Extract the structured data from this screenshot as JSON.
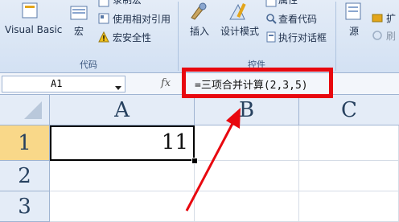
{
  "ribbon": {
    "group_code_label": "代码",
    "group_controls_label": "控件",
    "visual_basic": "Visual Basic",
    "macro": "宏",
    "record_macro": "录制宏",
    "use_relative": "使用相对引用",
    "macro_security": "宏安全性",
    "insert": "插入",
    "design_mode": "设计模式",
    "properties": "属性",
    "view_code": "查看代码",
    "run_dialog": "执行对话框",
    "source": "源",
    "expand": "扩",
    "refresh": "刷"
  },
  "formula_bar": {
    "name_box": "A1",
    "fx": "fx",
    "formula": "=三项合并计算(2,3,5)"
  },
  "sheet": {
    "columns": [
      "A",
      "B",
      "C"
    ],
    "rows": [
      "1",
      "2",
      "3"
    ],
    "a1_value": "11"
  },
  "colors": {
    "highlight": "#e8080f"
  }
}
